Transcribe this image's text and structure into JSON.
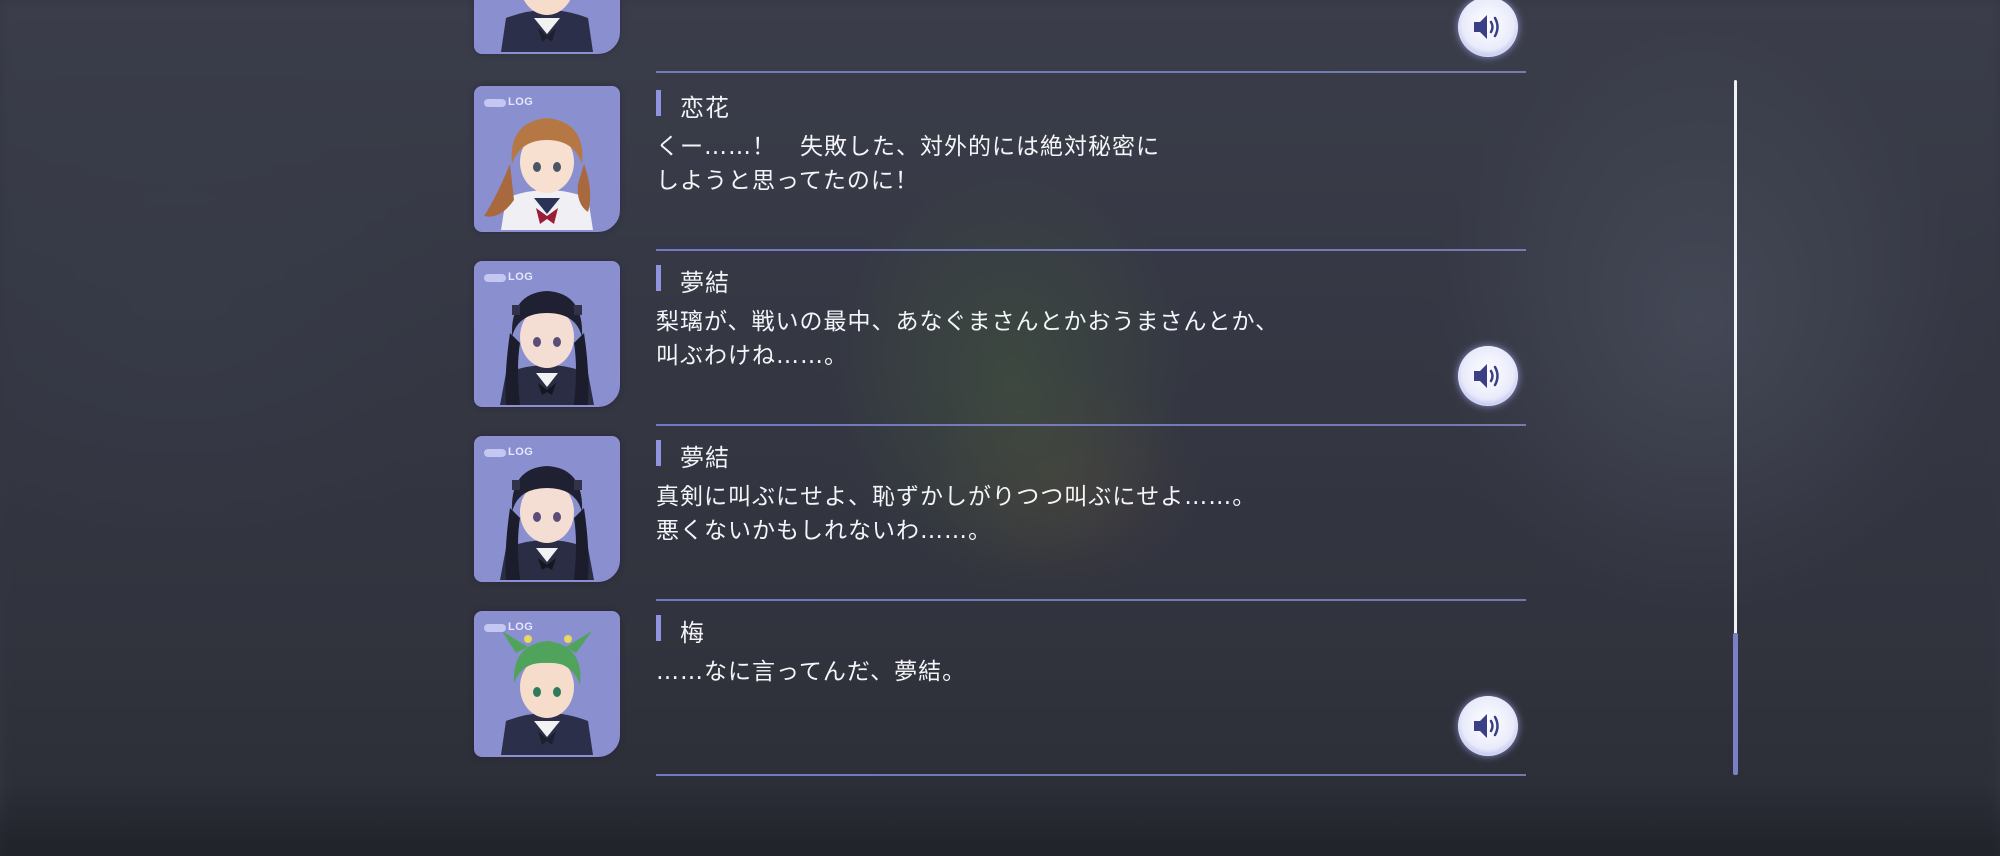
{
  "window": {
    "title": ""
  },
  "backlog": {
    "badge_text": "LOG",
    "entries": [
      {
        "speaker": "",
        "text": "",
        "character": "ume",
        "has_voice": true
      },
      {
        "speaker": "恋花",
        "text": "くー……！　失敗した、対外的には絶対秘密に\nしようと思ってたのに！",
        "character": "renka",
        "has_voice": false
      },
      {
        "speaker": "夢結",
        "text": "梨璃が、戦いの最中、あなぐまさんとかおうまさんとか、\n叫ぶわけね……。",
        "character": "yuyu",
        "has_voice": true
      },
      {
        "speaker": "夢結",
        "text": "真剣に叫ぶにせよ、恥ずかしがりつつ叫ぶにせよ……。\n悪くないかもしれないわ……。",
        "character": "yuyu",
        "has_voice": false
      },
      {
        "speaker": "梅",
        "text": "……なに言ってんだ、夢結。",
        "character": "ume",
        "has_voice": true
      }
    ]
  },
  "scrollbar": {
    "position_fraction": 1.0,
    "visible_fraction": 0.2
  },
  "colors": {
    "accent": "#8f93e0",
    "separator": "#787cc8",
    "text": "#f4f5f8",
    "portrait_frame": "#8d8fd0",
    "voice_icon": "#3a3f86"
  },
  "icons": {
    "voice": "speaker-volume-icon",
    "portrait": "character-portrait"
  }
}
